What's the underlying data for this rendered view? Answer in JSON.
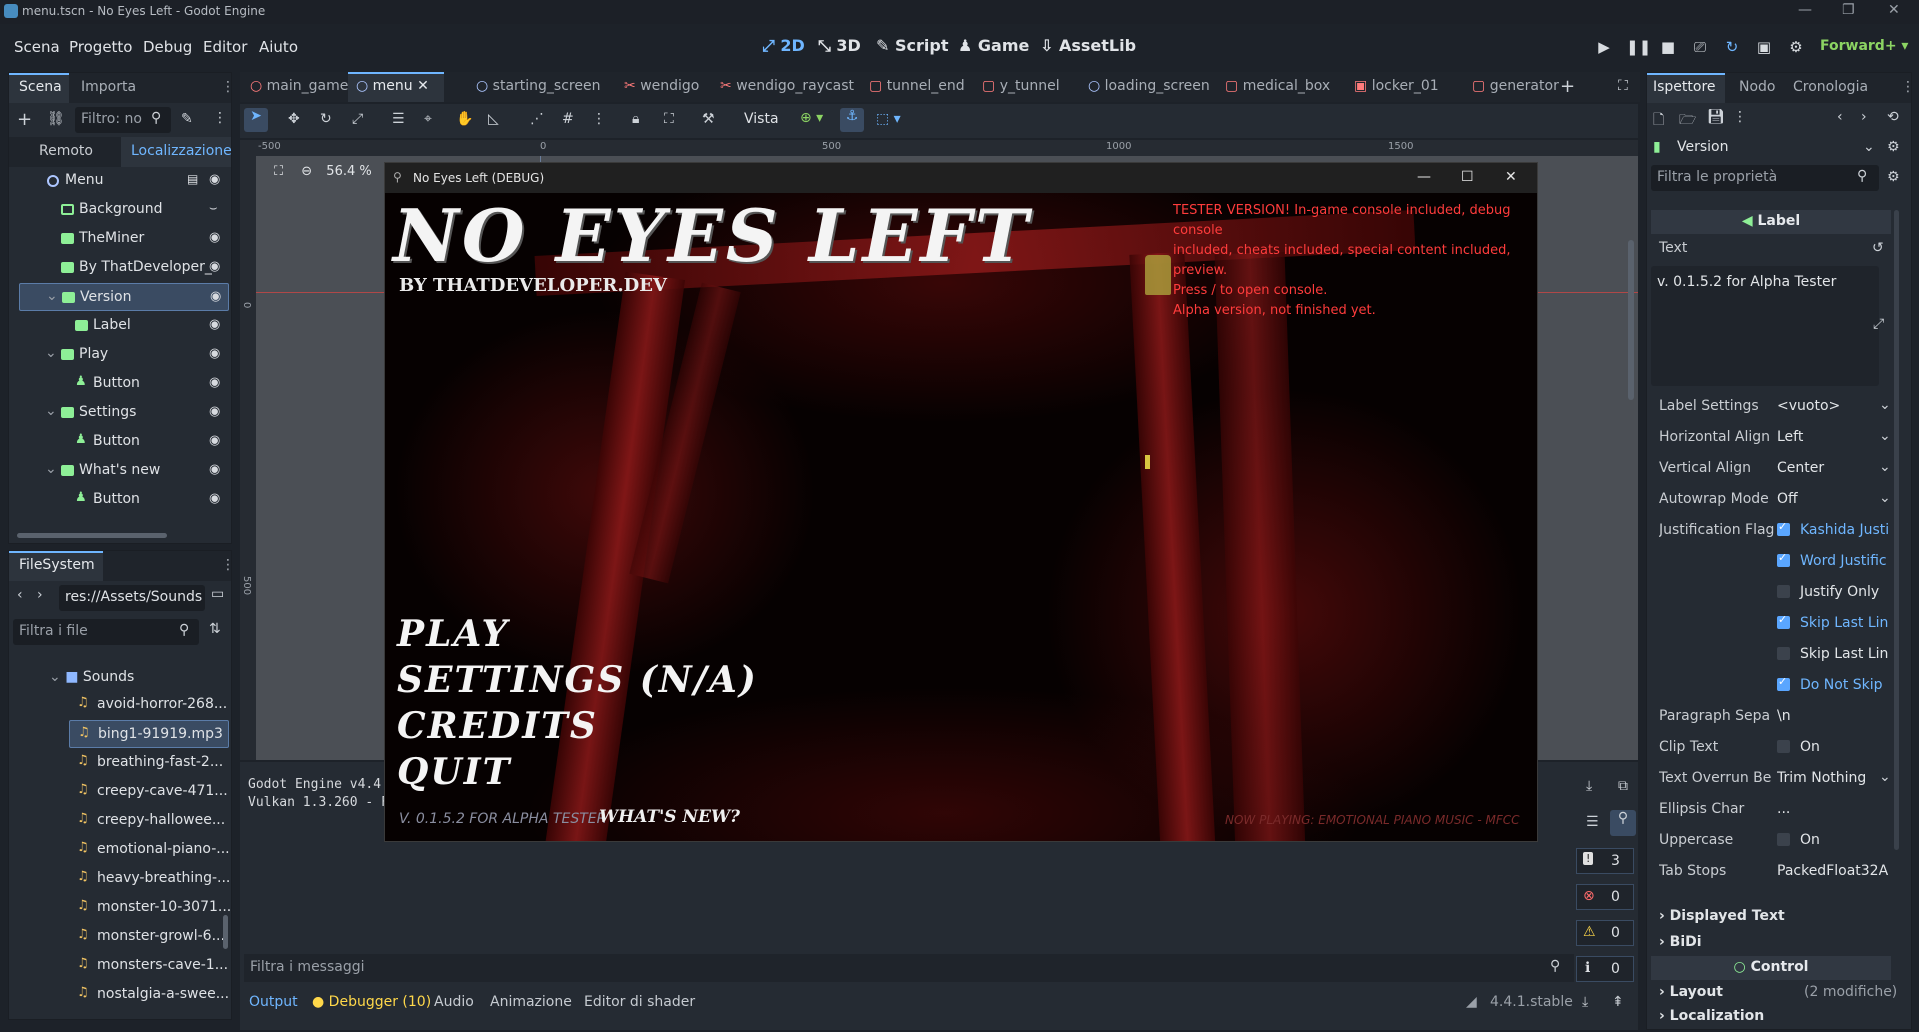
{
  "titlebar": {
    "title": "menu.tscn - No Eyes Left - Godot Engine"
  },
  "menubar": {
    "items": [
      "Scena",
      "Progetto",
      "Debug",
      "Editor",
      "Aiuto"
    ],
    "workspaces": [
      "2D",
      "3D",
      "Script",
      "Game",
      "AssetLib"
    ],
    "renderer": "Forward+"
  },
  "scene_dock": {
    "tabs": [
      "Scena",
      "Importa"
    ],
    "filter_placeholder": "Filtro: no",
    "subtabs": [
      "Remoto",
      "Localizzazione"
    ],
    "nodes": [
      {
        "label": "Menu",
        "indent": 0,
        "kind": "root"
      },
      {
        "label": "Background",
        "indent": 1,
        "kind": "rect"
      },
      {
        "label": "TheMiner",
        "indent": 1,
        "kind": "label"
      },
      {
        "label": "By ThatDeveloper_",
        "indent": 1,
        "kind": "label"
      },
      {
        "label": "Version",
        "indent": 1,
        "kind": "label",
        "selected": true
      },
      {
        "label": "Label",
        "indent": 2,
        "kind": "label"
      },
      {
        "label": "Play",
        "indent": 1,
        "kind": "label"
      },
      {
        "label": "Button",
        "indent": 2,
        "kind": "button"
      },
      {
        "label": "Settings",
        "indent": 1,
        "kind": "label"
      },
      {
        "label": "Button",
        "indent": 2,
        "kind": "button"
      },
      {
        "label": "What's new",
        "indent": 1,
        "kind": "label"
      },
      {
        "label": "Button",
        "indent": 2,
        "kind": "button"
      }
    ]
  },
  "filesystem": {
    "tab": "FileSystem",
    "path": "res://Assets/Sounds",
    "filter_placeholder": "Filtra i file",
    "folder": "Sounds",
    "files": [
      "avoid-horror-268...",
      "bing1-91919.mp3",
      "breathing-fast-2...",
      "creepy-cave-471...",
      "creepy-hallowee...",
      "emotional-piano-...",
      "heavy-breathing-...",
      "monster-10-3071...",
      "monster-growl-6...",
      "monsters-cave-1...",
      "nostalgia-a-swee..."
    ]
  },
  "editor_tabs": [
    "main_game",
    "menu",
    "starting_screen",
    "wendigo",
    "wendigo_raycast",
    "tunnel_end",
    "y_tunnel",
    "loading_screen",
    "medical_box",
    "locker_01",
    "generator"
  ],
  "toolbar": {
    "view_label": "Vista",
    "zoom": "56.4 %"
  },
  "ruler": {
    "marks": [
      "-500",
      "0",
      "500",
      "1000",
      "1500"
    ],
    "vmarks": [
      "0",
      "500"
    ]
  },
  "game_window": {
    "title": "No Eyes Left (DEBUG)",
    "game_title": "NO EYES LEFT",
    "subtitle": "BY THATDEVELOPER.DEV",
    "tester_notice": [
      "TESTER VERSION! In-game console included, debug console",
      "included, cheats included, special content included, preview.",
      "Press / to open console.",
      "Alpha version, not finished yet."
    ],
    "menu": [
      "PLAY",
      "SETTINGS (N/A)",
      "CREDITS",
      "QUIT"
    ],
    "version": "V. 0.1.5.2 FOR ALPHA TESTER",
    "whats_new": "WHAT'S NEW?",
    "now_playing": "NOW PLAYING: EMOTIONAL PIANO MUSIC - MFCC"
  },
  "output": {
    "lines": [
      "Godot Engine v4.4.",
      "Vulkan 1.3.260 - F"
    ],
    "filter_placeholder": "Filtra i messaggi",
    "counters": [
      "3",
      "0",
      "0",
      "0"
    ]
  },
  "bottom_tabs": [
    "Output",
    "Debugger (10)",
    "Audio",
    "Animazione",
    "Editor di shader"
  ],
  "version_label": "4.4.1.stable",
  "inspector": {
    "tabs": [
      "Ispettore",
      "Nodo",
      "Cronologia"
    ],
    "object": "Version",
    "filter_placeholder": "Filtra le proprietà",
    "class_header": "Label",
    "text_label": "Text",
    "text_value": "v. 0.1.5.2 for Alpha Tester",
    "props": [
      {
        "name": "Label Settings",
        "value": "<vuoto>"
      },
      {
        "name": "Horizontal Align",
        "value": "Left"
      },
      {
        "name": "Vertical Align",
        "value": "Center"
      },
      {
        "name": "Autowrap Mode",
        "value": "Off"
      },
      {
        "name": "Justification Flag",
        "value": "Kashida Justi",
        "check": true
      },
      {
        "name": "",
        "value": "Word Justific",
        "check": true
      },
      {
        "name": "",
        "value": "Justify Only",
        "check": false
      },
      {
        "name": "",
        "value": "Skip Last Lin",
        "check": true
      },
      {
        "name": "",
        "value": "Skip Last Lin",
        "check": false
      },
      {
        "name": "",
        "value": "Do Not Skip",
        "check": true
      },
      {
        "name": "Paragraph Sepa",
        "value": "\\n"
      },
      {
        "name": "Clip Text",
        "value": "On",
        "check": false
      },
      {
        "name": "Text Overrun Be",
        "value": "Trim Nothing"
      },
      {
        "name": "Ellipsis Char",
        "value": "..."
      },
      {
        "name": "Uppercase",
        "value": "On",
        "check": false
      },
      {
        "name": "Tab Stops",
        "value": "PackedFloat32A"
      }
    ],
    "groups": [
      "Displayed Text",
      "BiDi"
    ],
    "control_header": "Control",
    "layout_label": "Layout",
    "layout_note": "(2 modifiche)",
    "localization_label": "Localization"
  },
  "colors": {
    "accent": "#6fb6ff",
    "node_green": "#8eef97",
    "tester_red": "#ff3c3c"
  }
}
